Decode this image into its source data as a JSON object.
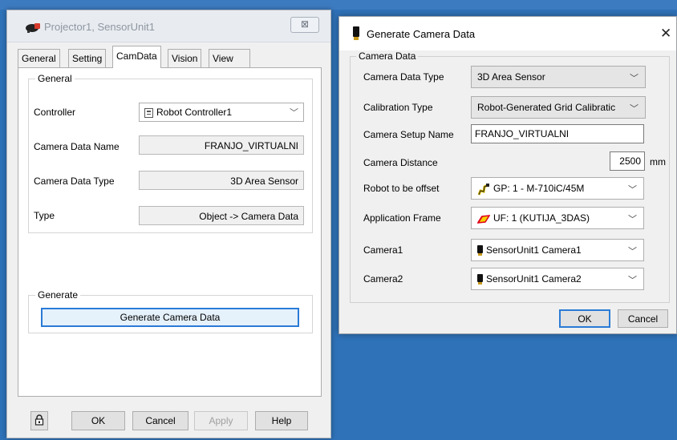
{
  "window1": {
    "title": "Projector1, SensorUnit1",
    "close_glyph": "⊠",
    "tabs": [
      "General",
      "Setting",
      "CamData",
      "Vision",
      "View"
    ],
    "active_tab": "CamData",
    "general_group": {
      "label": "General",
      "controller_label": "Controller",
      "controller_value": "Robot Controller1",
      "camera_data_name_label": "Camera Data Name",
      "camera_data_name_value": "FRANJO_VIRTUALNI",
      "camera_data_type_label": "Camera Data Type",
      "camera_data_type_value": "3D Area Sensor",
      "type_label": "Type",
      "type_value": "Object -> Camera Data"
    },
    "generate_group": {
      "label": "Generate",
      "button_label": "Generate Camera Data"
    },
    "footer": {
      "ok": "OK",
      "cancel": "Cancel",
      "apply": "Apply",
      "help": "Help"
    }
  },
  "window2": {
    "title": "Generate Camera Data",
    "close_glyph": "✕",
    "group_label": "Camera Data",
    "fields": {
      "camera_data_type_label": "Camera Data Type",
      "camera_data_type_value": "3D Area Sensor",
      "calibration_type_label": "Calibration Type",
      "calibration_type_value": "Robot-Generated Grid Calibratic",
      "camera_setup_name_label": "Camera Setup Name",
      "camera_setup_name_value": "FRANJO_VIRTUALNI",
      "camera_distance_label": "Camera Distance",
      "camera_distance_value": "2500",
      "camera_distance_unit": "mm",
      "robot_offset_label": "Robot to be offset",
      "robot_offset_value": "GP: 1 - M-710iC/45M",
      "application_frame_label": "Application Frame",
      "application_frame_value": "UF: 1 (KUTIJA_3DAS)",
      "camera1_label": "Camera1",
      "camera1_value": "SensorUnit1 Camera1",
      "camera2_label": "Camera2",
      "camera2_value": "SensorUnit1 Camera2"
    },
    "buttons": {
      "ok": "OK",
      "cancel": "Cancel"
    }
  },
  "colors": {
    "desktop": "#2f72b8",
    "focus_border": "#2a7bd6",
    "disabled_text": "#a0a0a0"
  }
}
